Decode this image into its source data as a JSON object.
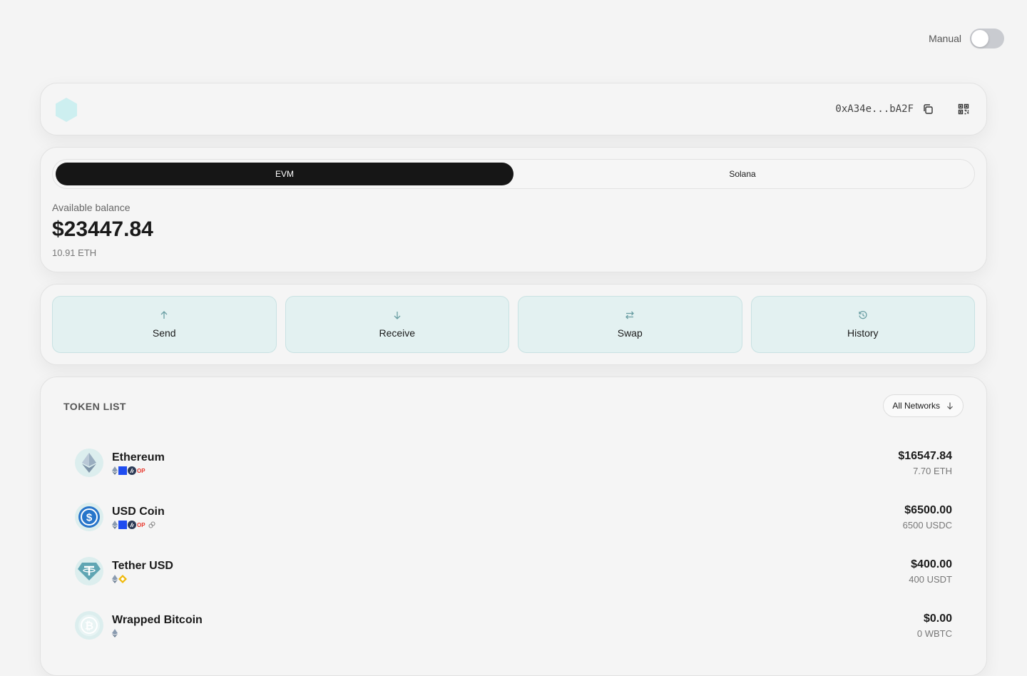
{
  "topbar": {
    "mode_label": "Manual",
    "toggle_on": false
  },
  "header": {
    "address": "0xA34e...bA2F",
    "logo_color": "#cdeff0"
  },
  "balance": {
    "tabs": [
      {
        "label": "EVM",
        "active": true
      },
      {
        "label": "Solana",
        "active": false
      }
    ],
    "available_label": "Available balance",
    "usd": "$23447.84",
    "eth": "10.91 ETH"
  },
  "actions": [
    {
      "label": "Send",
      "icon": "arrow-up-icon"
    },
    {
      "label": "Receive",
      "icon": "arrow-down-icon"
    },
    {
      "label": "Swap",
      "icon": "swap-icon"
    },
    {
      "label": "History",
      "icon": "history-icon"
    }
  ],
  "tokens": {
    "title": "TOKEN LIST",
    "network_filter": "All Networks",
    "items": [
      {
        "name": "Ethereum",
        "usd": "$16547.84",
        "amount": "7.70 ETH",
        "networks": [
          "eth",
          "base",
          "arb",
          "op"
        ],
        "icon": "ethereum-icon"
      },
      {
        "name": "USD Coin",
        "usd": "$6500.00",
        "amount": "6500 USDC",
        "networks": [
          "eth",
          "base",
          "arb",
          "op",
          "link"
        ],
        "icon": "usdc-icon"
      },
      {
        "name": "Tether USD",
        "usd": "$400.00",
        "amount": "400 USDT",
        "networks": [
          "eth",
          "bnb"
        ],
        "icon": "tether-icon"
      },
      {
        "name": "Wrapped Bitcoin",
        "usd": "$0.00",
        "amount": "0 WBTC",
        "networks": [
          "eth"
        ],
        "icon": "bitcoin-icon"
      }
    ]
  },
  "colors": {
    "accent_bg": "#e3f1f1",
    "accent_border": "#c9e2e3",
    "active_tab": "#161616"
  }
}
